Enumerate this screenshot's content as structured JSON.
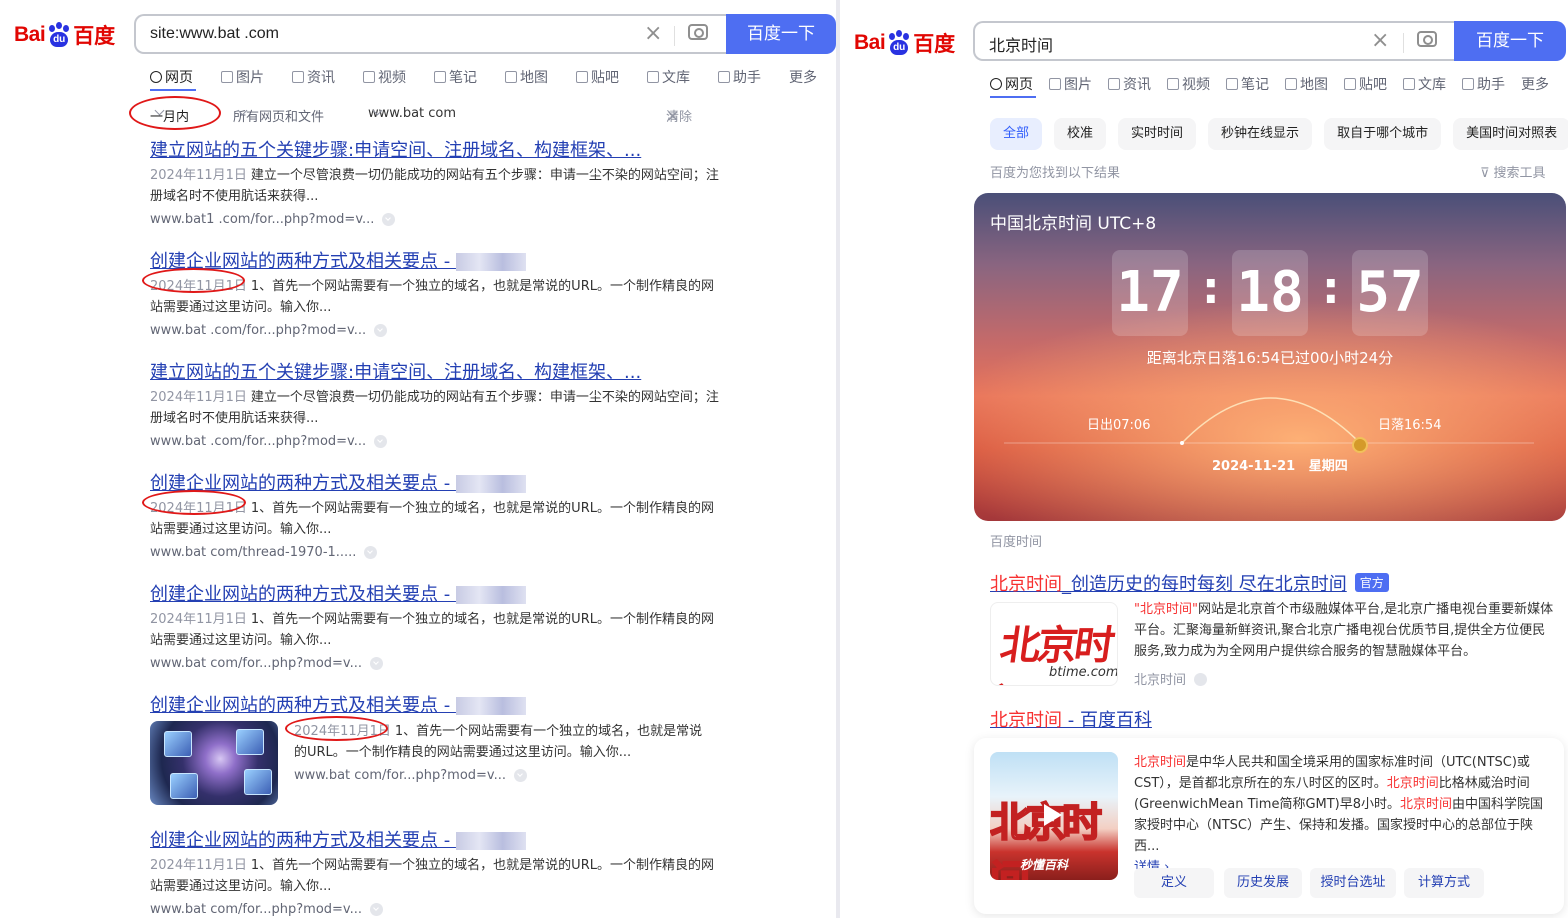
{
  "left": {
    "logo": {
      "bai": "Bai",
      "paw": "du",
      "du": "百度"
    },
    "search": {
      "query": "site:www.bat        .com",
      "button": "百度一下"
    },
    "tabs": [
      "网页",
      "图片",
      "资讯",
      "视频",
      "笔记",
      "地图",
      "贴吧",
      "文库",
      "助手",
      "更多"
    ],
    "filters": {
      "time": "一月内",
      "type": "所有网页和文件",
      "site": "www.bat        com",
      "clear": "清除"
    },
    "results": [
      {
        "title": "建立网站的五个关键步骤:申请空间、注册域名、构建框架、...",
        "date": "2024年11月1日",
        "abstract": "建立一个尽管浪费一切仍能成功的网站有五个步骤：申请一尘不染的网站空间；注册域名时不使用肮话来获得...",
        "url": "www.bat1   .com/for...php?mod=v..."
      },
      {
        "title": "创建企业网站的两种方式及相关要点 - ",
        "date": "2024年11月1日",
        "abstract": "1、首先一个网站需要有一个独立的域名，也就是常说的URL。一个制作精良的网站需要通过这里访问。输入你...",
        "url": "www.bat     .com/for...php?mod=v..."
      },
      {
        "title": "建立网站的五个关键步骤:申请空间、注册域名、构建框架、...",
        "date": "2024年11月1日",
        "abstract": "建立一个尽管浪费一切仍能成功的网站有五个步骤：申请一尘不染的网站空间；注册域名时不使用肮话来获得...",
        "url": "www.bat     .com/for...php?mod=v..."
      },
      {
        "title": "创建企业网站的两种方式及相关要点 - ",
        "date": "2024年11月1日",
        "abstract": "1、首先一个网站需要有一个独立的域名，也就是常说的URL。一个制作精良的网站需要通过这里访问。输入你...",
        "url": "www.bat     com/thread-1970-1....."
      },
      {
        "title": "创建企业网站的两种方式及相关要点 - ",
        "date": "2024年11月1日",
        "abstract": "1、首先一个网站需要有一个独立的域名，也就是常说的URL。一个制作精良的网站需要通过这里访问。输入你...",
        "url": "www.bat     com/for...php?mod=v..."
      },
      {
        "title": "创建企业网站的两种方式及相关要点 - ",
        "date": "2024年11月1日",
        "abstract": "1、首先一个网站需要有一个独立的域名，也就是常说的URL。一个制作精良的网站需要通过这里访问。输入你...",
        "url": "www.bat     com/for...php?mod=v..."
      },
      {
        "title": "创建企业网站的两种方式及相关要点 - ",
        "date": "2024年11月1日",
        "abstract": "1、首先一个网站需要有一个独立的域名，也就是常说的URL。一个制作精良的网站需要通过这里访问。输入你...",
        "url": "www.bat     com/for...php?mod=v..."
      }
    ]
  },
  "right": {
    "logo": {
      "bai": "Bai",
      "paw": "du",
      "du": "百度"
    },
    "search": {
      "query": "北京时间",
      "button": "百度一下"
    },
    "tabs": [
      "网页",
      "图片",
      "资讯",
      "视频",
      "笔记",
      "地图",
      "贴吧",
      "文库",
      "助手",
      "更多"
    ],
    "chips": [
      "全部",
      "校准",
      "实时时间",
      "秒钟在线显示",
      "取自于哪个城市",
      "美国时间对照表"
    ],
    "found": "百度为您找到以下结果",
    "tools": "搜索工具",
    "clock": {
      "title": "中国北京时间 UTC+8",
      "hh": "17",
      "mm": "18",
      "ss": "57",
      "sunset_note": "距离北京日落16:54已过00小时24分",
      "sunrise": "日出07:06",
      "sunset": "日落16:54",
      "date": "2024-11-21",
      "weekday": "星期四"
    },
    "clock_source": "百度时间",
    "r1": {
      "title_hl": "北京时间",
      "title_rest": "_创造历史的每时每刻 尽在北京时间",
      "badge": "官方",
      "logo_big": "北京时间",
      "logo_small": "btime.com",
      "abs_hl": "\"北京时间\"",
      "abs_rest": "网站是北京首个市级融媒体平台,是北京广播电视台重要新媒体平台。汇聚海量新鲜资讯,聚合北京广播电视台优质节目,提供全方位便民服务,致力成为为全网用户提供综合服务的智慧融媒体平台。",
      "site": "北京时间"
    },
    "r2": {
      "title_hl": "北京时间",
      "title_rest": " - 百度百科",
      "abs": [
        {
          "hl": "北京时间",
          "t": "是中华人民共和国全境采用的国家标准时间（UTC(NTSC)或CST），是首都北京所在的东八时区的区时。"
        },
        {
          "hl": "北京时间",
          "t": "比格林威治时间(GreenwichMean Time简称GMT)早8小时。"
        },
        {
          "hl": "北京时间",
          "t": "由中国科学院国家授时中心（NTSC）产生、保持和发播。国家授时中心的总部位于陕西..."
        }
      ],
      "more": "详情",
      "thumb_text": "北京时间",
      "thumb_tag": "秒懂百科",
      "buttons": [
        "定义",
        "历史发展",
        "授时台选址",
        "计算方式"
      ]
    }
  }
}
